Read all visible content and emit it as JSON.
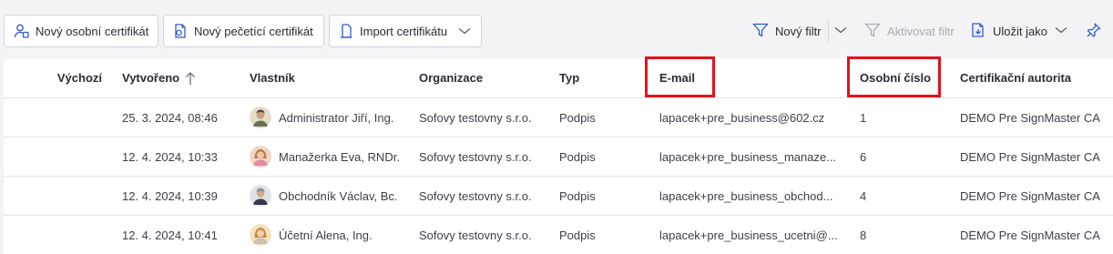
{
  "toolbar": {
    "new_personal_cert": "Nový osobní certifikát",
    "new_seal_cert": "Nový pečetící certifikát",
    "import_cert": "Import certifikátu",
    "new_filter": "Nový filtr",
    "activate_filter": "Aktivovat filtr",
    "save_as": "Uložit jako"
  },
  "table": {
    "columns": {
      "default": "Výchozí",
      "created": "Vytvořeno",
      "owner": "Vlastník",
      "organization": "Organizace",
      "type": "Typ",
      "email": "E-mail",
      "personal_number": "Osobní číslo",
      "ca": "Certifikační autorita"
    },
    "sort": {
      "column": "created",
      "direction": "ascending"
    },
    "rows": [
      {
        "created": "25. 3. 2024, 08:46",
        "owner": "Administrator Jiří, Ing.",
        "organization": "Sofovy testovny s.r.o.",
        "type": "Podpis",
        "email": "lapacek+pre_business@602.cz",
        "personal_number": "1",
        "ca": "DEMO Pre SignMaster CA"
      },
      {
        "created": "12. 4. 2024, 10:33",
        "owner": "Manažerka Eva, RNDr.",
        "organization": "Sofovy testovny s.r.o.",
        "type": "Podpis",
        "email": "lapacek+pre_business_manaze...",
        "personal_number": "6",
        "ca": "DEMO Pre SignMaster CA"
      },
      {
        "created": "12. 4. 2024, 10:39",
        "owner": "Obchodník Václav, Bc.",
        "organization": "Sofovy testovny s.r.o.",
        "type": "Podpis",
        "email": "lapacek+pre_business_obchod...",
        "personal_number": "4",
        "ca": "DEMO Pre SignMaster CA"
      },
      {
        "created": "12. 4. 2024, 10:41",
        "owner": "Účetní Alena, Ing.",
        "organization": "Sofovy testovny s.r.o.",
        "type": "Podpis",
        "email": "lapacek+pre_business_ucetni@...",
        "personal_number": "8",
        "ca": "DEMO Pre SignMaster CA"
      }
    ]
  },
  "colors": {
    "accent": "#2f5bd3",
    "highlight": "#e3121b",
    "disabled": "#a8abb5"
  },
  "icons": {
    "new_personal_cert": "user-certificate-icon",
    "new_seal_cert": "seal-document-icon",
    "import_cert": "import-document-icon",
    "new_filter": "funnel-icon",
    "activate_filter": "funnel-disabled-icon",
    "save_as": "save-document-icon",
    "pin": "pin-icon"
  }
}
